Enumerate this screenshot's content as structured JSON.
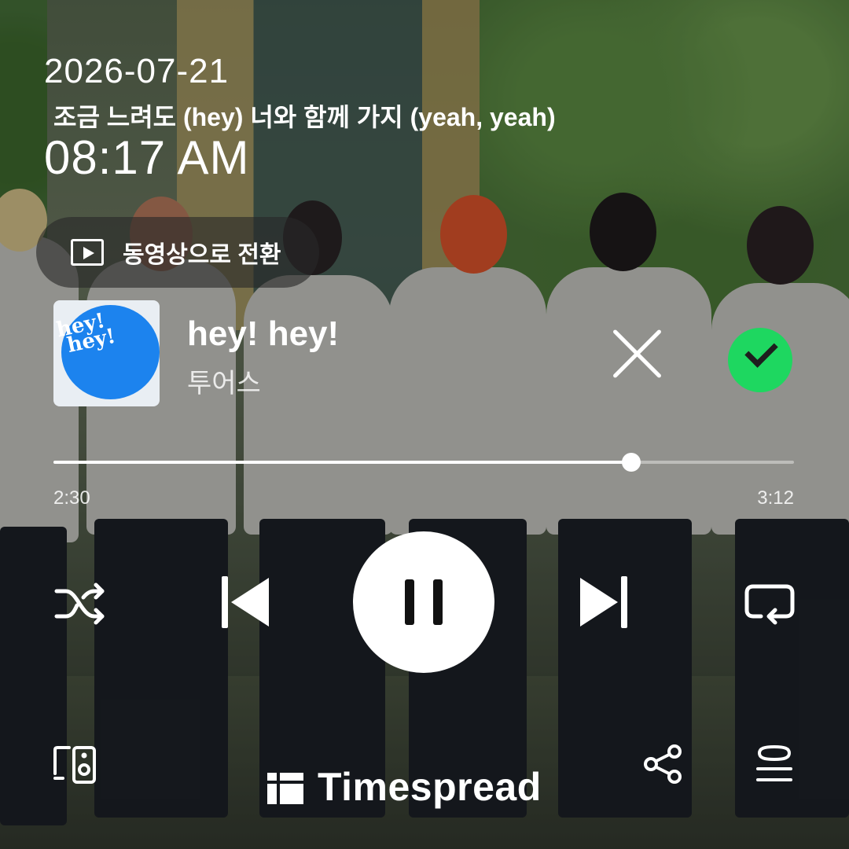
{
  "status": {
    "date": "2026-07-21",
    "time": "08:17 AM"
  },
  "lyric": "조금 느려도 (hey) 너와 함께 가지 (yeah, yeah)",
  "switch_video": {
    "icon": "video-play-icon",
    "label": "동영상으로 전환"
  },
  "track": {
    "album_art_text": "hey!\nhey!",
    "title": "hey! hey!",
    "artist": "투어스",
    "elapsed": "2:30",
    "duration": "3:12",
    "progress_fraction": 0.78
  },
  "actions": {
    "close_icon": "close-icon",
    "saved_icon": "check-circle-icon",
    "saved_color": "#1ed760"
  },
  "controls": {
    "shuffle_icon": "shuffle-icon",
    "previous_icon": "skip-previous-icon",
    "pause_icon": "pause-icon",
    "next_icon": "skip-next-icon",
    "repeat_icon": "repeat-icon"
  },
  "bottom_bar": {
    "devices_icon": "devices-icon",
    "brand_name": "Timespread",
    "share_icon": "share-icon",
    "queue_icon": "queue-icon"
  }
}
